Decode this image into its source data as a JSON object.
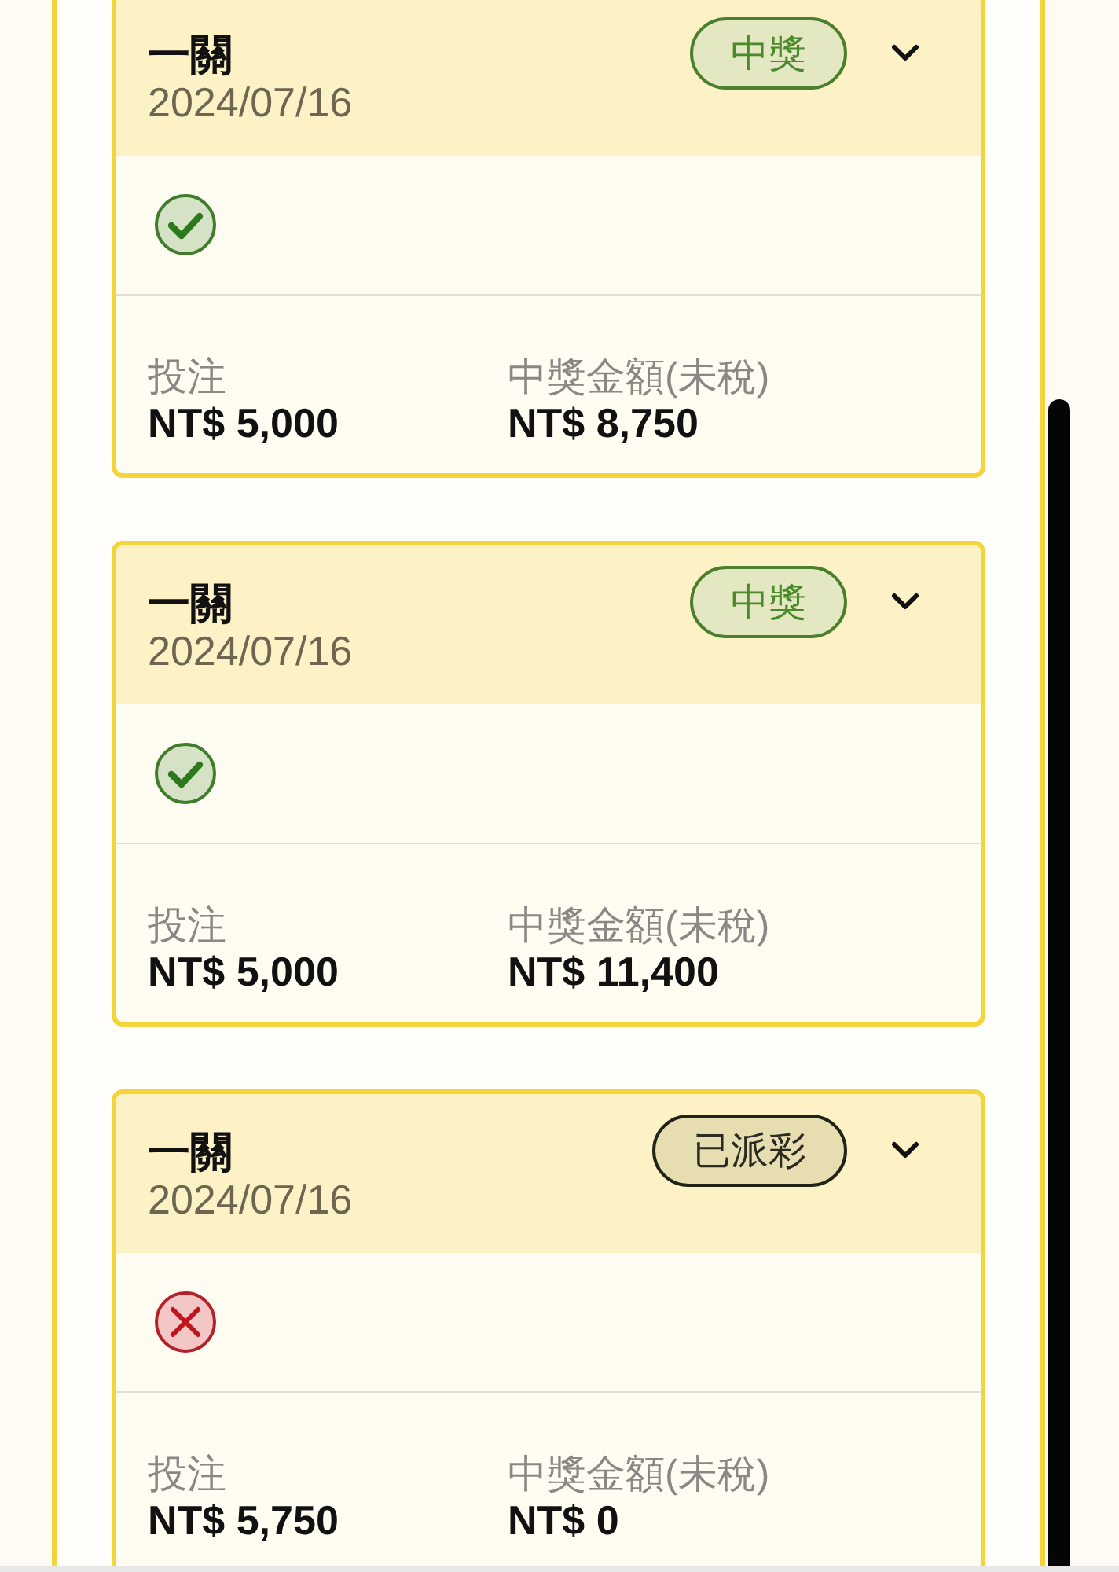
{
  "cards": [
    {
      "title": "一關",
      "date": "2024/07/16",
      "status": {
        "kind": "won",
        "label": "中獎"
      },
      "won": true,
      "stake_label": "投注",
      "stake": "NT$ 5,000",
      "payout_label": "中獎金額(未稅)",
      "payout": "NT$ 8,750"
    },
    {
      "title": "一關",
      "date": "2024/07/16",
      "status": {
        "kind": "won",
        "label": "中獎"
      },
      "won": true,
      "stake_label": "投注",
      "stake": "NT$ 5,000",
      "payout_label": "中獎金額(未稅)",
      "payout": "NT$ 11,400"
    },
    {
      "title": "一關",
      "date": "2024/07/16",
      "status": {
        "kind": "paid",
        "label": "已派彩"
      },
      "won": false,
      "stake_label": "投注",
      "stake": "NT$ 5,750",
      "payout_label": "中獎金額(未稅)",
      "payout": "NT$ 0"
    }
  ]
}
